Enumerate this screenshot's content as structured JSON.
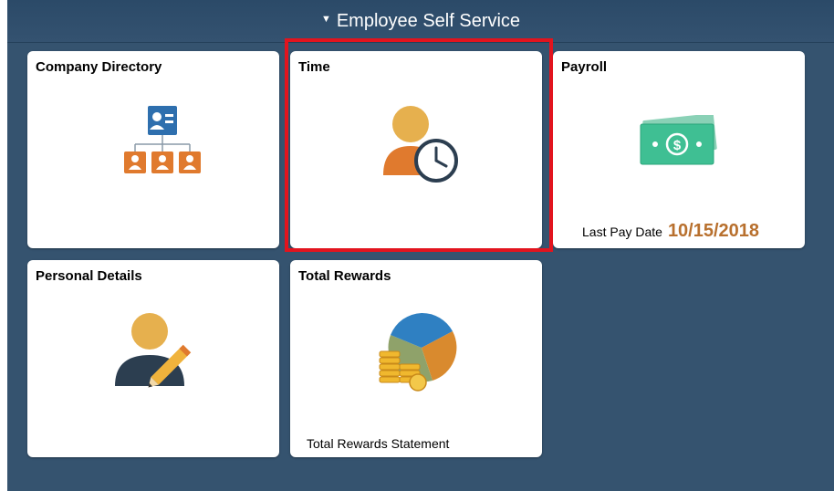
{
  "header": {
    "title": "Employee Self Service",
    "caret_icon": "triangle-down-icon"
  },
  "tiles": [
    {
      "title": "Company Directory",
      "icon": "org-chart-icon"
    },
    {
      "title": "Time",
      "icon": "person-clock-icon"
    },
    {
      "title": "Payroll",
      "icon": "cash-icon",
      "footer_label": "Last Pay Date",
      "footer_value": "10/15/2018"
    },
    {
      "title": "Personal Details",
      "icon": "person-pencil-icon"
    },
    {
      "title": "Total Rewards",
      "icon": "pie-coins-icon",
      "footer_label": "Total Rewards Statement"
    }
  ],
  "colors": {
    "background": "#35536f",
    "tile": "#ffffff",
    "highlight": "#e2141e",
    "pay_date": "#b8702e"
  }
}
